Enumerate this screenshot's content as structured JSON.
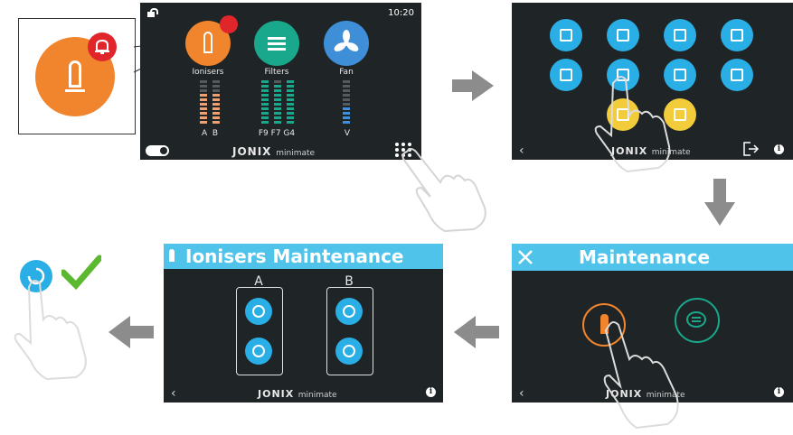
{
  "zoom_callout": {
    "icon": "ioniser-icon",
    "badge": "bell-icon"
  },
  "screen1": {
    "time": "10:20",
    "tiles": [
      {
        "label": "Ionisers",
        "color": "#f0852d"
      },
      {
        "label": "Filters",
        "color": "#19a88c"
      },
      {
        "label": "Fan",
        "color": "#3f8fd8"
      }
    ],
    "ionisers_bars": [
      "A",
      "B"
    ],
    "filters_bars": "F9 F7 G4",
    "fan_bars": "V",
    "brand": "JONIX",
    "brand_sub": "minimate"
  },
  "screen2": {
    "icons": [
      "calendar-icon",
      "display-icon",
      "screen-icon",
      "lock-icon",
      "clock-icon",
      "maintenance-icon",
      "file-icon",
      "settings-icon",
      "photo-icon",
      "video-icon"
    ],
    "brand": "JONIX",
    "brand_sub": "minimate"
  },
  "screen3": {
    "title": "Maintenance",
    "brand": "JONIX",
    "brand_sub": "minimate"
  },
  "screen4": {
    "title": "Ionisers Maintenance",
    "columns": [
      "A",
      "B"
    ],
    "brand": "JONIX",
    "brand_sub": "minimate"
  },
  "colors": {
    "accent": "#4fc3ea",
    "orange": "#f0852d",
    "green": "#19a88c",
    "check": "#5cb82e",
    "arrow": "#8c8c8c"
  }
}
